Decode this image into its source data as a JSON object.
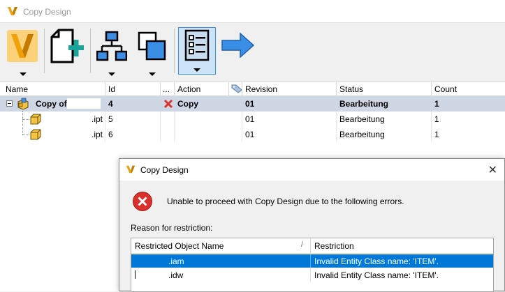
{
  "window": {
    "title": "Copy Design",
    "logo_icon": "autodesk-vault-logo"
  },
  "toolbar": {
    "buttons": [
      {
        "name": "vault-menu",
        "icon": "vault-v-icon",
        "has_dropdown": true
      },
      {
        "name": "add-file",
        "icon": "add-file-icon",
        "has_dropdown": false
      },
      {
        "name": "structure",
        "icon": "hierarchy-icon",
        "has_dropdown": true
      },
      {
        "name": "copy-view",
        "icon": "overlap-squares-icon",
        "has_dropdown": true
      },
      {
        "name": "list-view",
        "icon": "checklist-icon",
        "has_dropdown": true,
        "active": true
      },
      {
        "name": "next",
        "icon": "arrow-right-icon",
        "has_dropdown": false
      }
    ]
  },
  "grid": {
    "columns": [
      "Name",
      "Id",
      "...",
      "Action",
      "",
      "Revision",
      "Status",
      "Count"
    ],
    "rows": [
      {
        "name": "Copy of",
        "id": "4",
        "action": "Copy",
        "revision": "01",
        "status": "Bearbeitung",
        "count": "1",
        "selected": true,
        "bold": true,
        "expanded": true
      },
      {
        "name": ".ipt",
        "id": "5",
        "action": "",
        "revision": "01",
        "status": "Bearbeitung",
        "count": "1",
        "selected": false,
        "bold": false
      },
      {
        "name": ".ipt",
        "id": "6",
        "action": "",
        "revision": "01",
        "status": "Bearbeitung",
        "count": "1",
        "selected": false,
        "bold": false
      }
    ]
  },
  "dialog": {
    "title": "Copy Design",
    "close_symbol": "✕",
    "message": "Unable to proceed with Copy Design due to the following errors.",
    "reason_label": "Reason for restriction:",
    "list": {
      "columns": [
        "Restricted Object Name",
        "Restriction"
      ],
      "sort_indicator": "/",
      "rows": [
        {
          "name": ".iam",
          "restriction": "Invalid Entity Class name: 'ITEM'.",
          "selected": true
        },
        {
          "name": ".idw",
          "restriction": "Invalid Entity Class name: 'ITEM'.",
          "selected": false
        }
      ]
    }
  },
  "colors": {
    "accent_orange": "#f5a623",
    "selection_gray": "#cfd6e4",
    "selection_blue": "#0078d7",
    "error_red": "#d9302b",
    "arrow_blue": "#3a8ee6"
  }
}
